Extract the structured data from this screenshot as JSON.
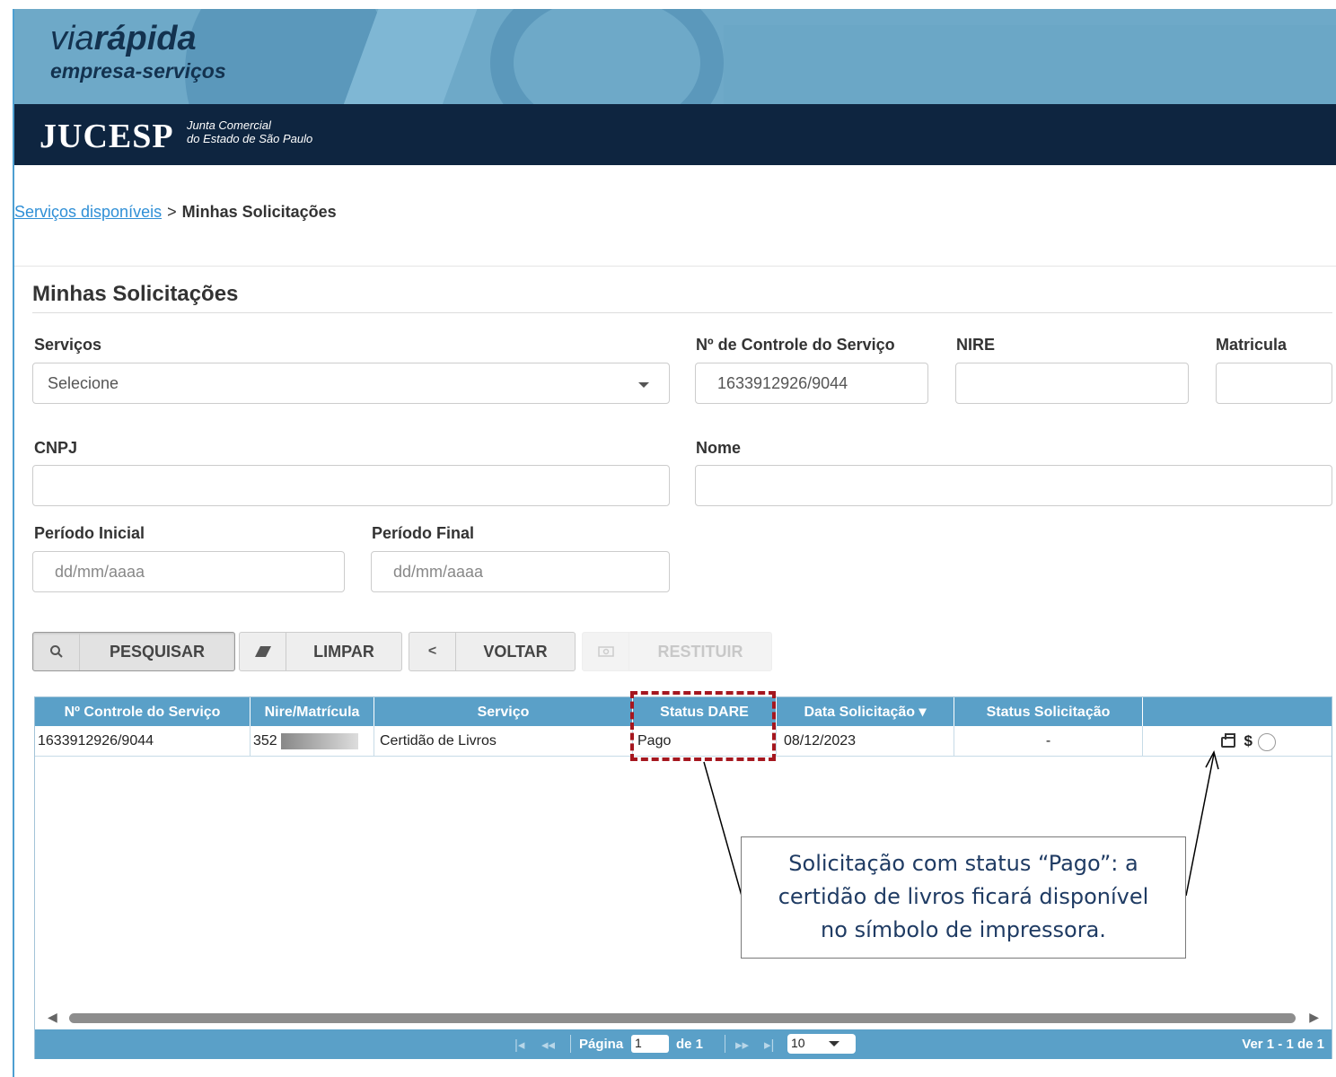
{
  "header": {
    "logo_via": "via",
    "logo_rapida": "rápida",
    "logo_sub": "empresa-serviços",
    "org": "JUCESP",
    "org_sub_line1": "Junta Comercial",
    "org_sub_line2": "do Estado de São Paulo"
  },
  "breadcrumb": {
    "link": "Serviços disponíveis",
    "separator": ">",
    "current": "Minhas Solicitações"
  },
  "page": {
    "title": "Minhas Solicitações"
  },
  "form": {
    "servicos_label": "Serviços",
    "servicos_value": "Selecione",
    "controle_label": "Nº de Controle do Serviço",
    "controle_value": "1633912926/9044",
    "nire_label": "NIRE",
    "nire_value": "",
    "matricula_label": "Matricula",
    "matricula_value": "",
    "cnpj_label": "CNPJ",
    "cnpj_value": "",
    "nome_label": "Nome",
    "nome_value": "",
    "periodo_inicial_label": "Período Inicial",
    "periodo_inicial_placeholder": "dd/mm/aaaa",
    "periodo_final_label": "Período Final",
    "periodo_final_placeholder": "dd/mm/aaaa"
  },
  "buttons": {
    "pesquisar": "PESQUISAR",
    "limpar": "LIMPAR",
    "voltar": "VOLTAR",
    "restituir": "RESTITUIR",
    "voltar_icon_glyph": "<"
  },
  "grid": {
    "columns": [
      "Nº Controle do Serviço",
      "Nire/Matrícula",
      "Serviço",
      "Status DARE",
      "Data Solicitação",
      "Status Solicitação",
      ""
    ],
    "sort_glyph": "▾",
    "rows": [
      {
        "controle": "1633912926/9044",
        "nire": "352",
        "servico": "Certidão de Livros",
        "status_dare": "Pago",
        "data": "08/12/2023",
        "status_solicitacao": "-",
        "dollar": "$"
      }
    ],
    "pager": {
      "pagina_label": "Página",
      "page_value": "1",
      "de_label": "de 1",
      "page_size": "10",
      "summary": "Ver 1 - 1 de 1"
    }
  },
  "annotation": {
    "callout_line1": "Solicitação com status “Pago”: a",
    "callout_line2": "certidão de livros ficará disponível",
    "callout_line3": "no símbolo de impressora.",
    "highlight_color": "#a5171f"
  },
  "colors": {
    "banner": "#6ea9c8",
    "darkbar": "#0e2540",
    "grid_header": "#5aa0c8",
    "link": "#2f8fd6"
  },
  "icons": [
    "search-icon",
    "eraser-icon",
    "chevron-left-icon",
    "camera-icon",
    "printer-icon",
    "dollar-icon",
    "checkbox-icon",
    "caret-down-icon"
  ]
}
